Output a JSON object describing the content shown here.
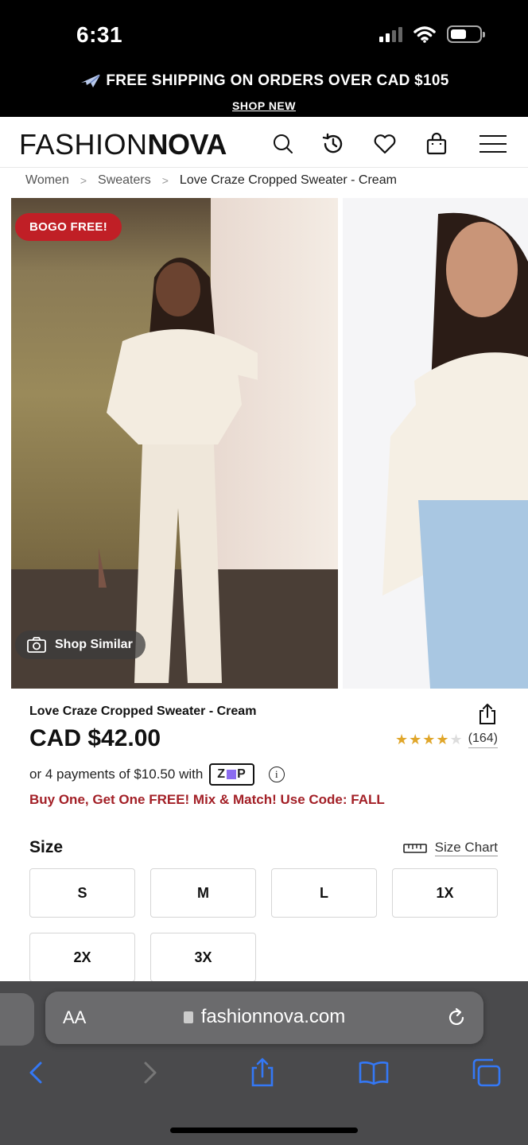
{
  "status_bar": {
    "time": "6:31"
  },
  "promo": {
    "text": "FREE SHIPPING ON ORDERS OVER CAD $105",
    "link": "SHOP NEW"
  },
  "header": {
    "logo_light": "FASHION",
    "logo_bold": "NOVA",
    "icons": [
      "search-icon",
      "history-icon",
      "heart-icon",
      "bag-icon",
      "menu-icon"
    ]
  },
  "breadcrumb": {
    "items": [
      "Women",
      "Sweaters",
      "Love Craze Cropped Sweater - Cream"
    ]
  },
  "gallery": {
    "badge": "BOGO FREE!",
    "shop_similar": "Shop Similar"
  },
  "product": {
    "title": "Love Craze Cropped Sweater - Cream",
    "price": "CAD $42.00",
    "rating": 4,
    "rating_max": 5,
    "review_count": "(164)",
    "payments_text": "or 4 payments of $10.50 with",
    "payment_provider": "zip",
    "promo_text": "Buy One, Get One FREE! Mix & Match! Use Code: FALL"
  },
  "size": {
    "label": "Size",
    "chart_link": "Size Chart",
    "options": [
      "S",
      "M",
      "L",
      "1X",
      "2X",
      "3X"
    ]
  },
  "browser": {
    "aa_label": "AA",
    "url": "fashionnova.com"
  },
  "colors": {
    "accent_red": "#c01f26",
    "promo_red": "#a32027",
    "star": "#e0a62a",
    "ios_blue": "#3478f6"
  }
}
